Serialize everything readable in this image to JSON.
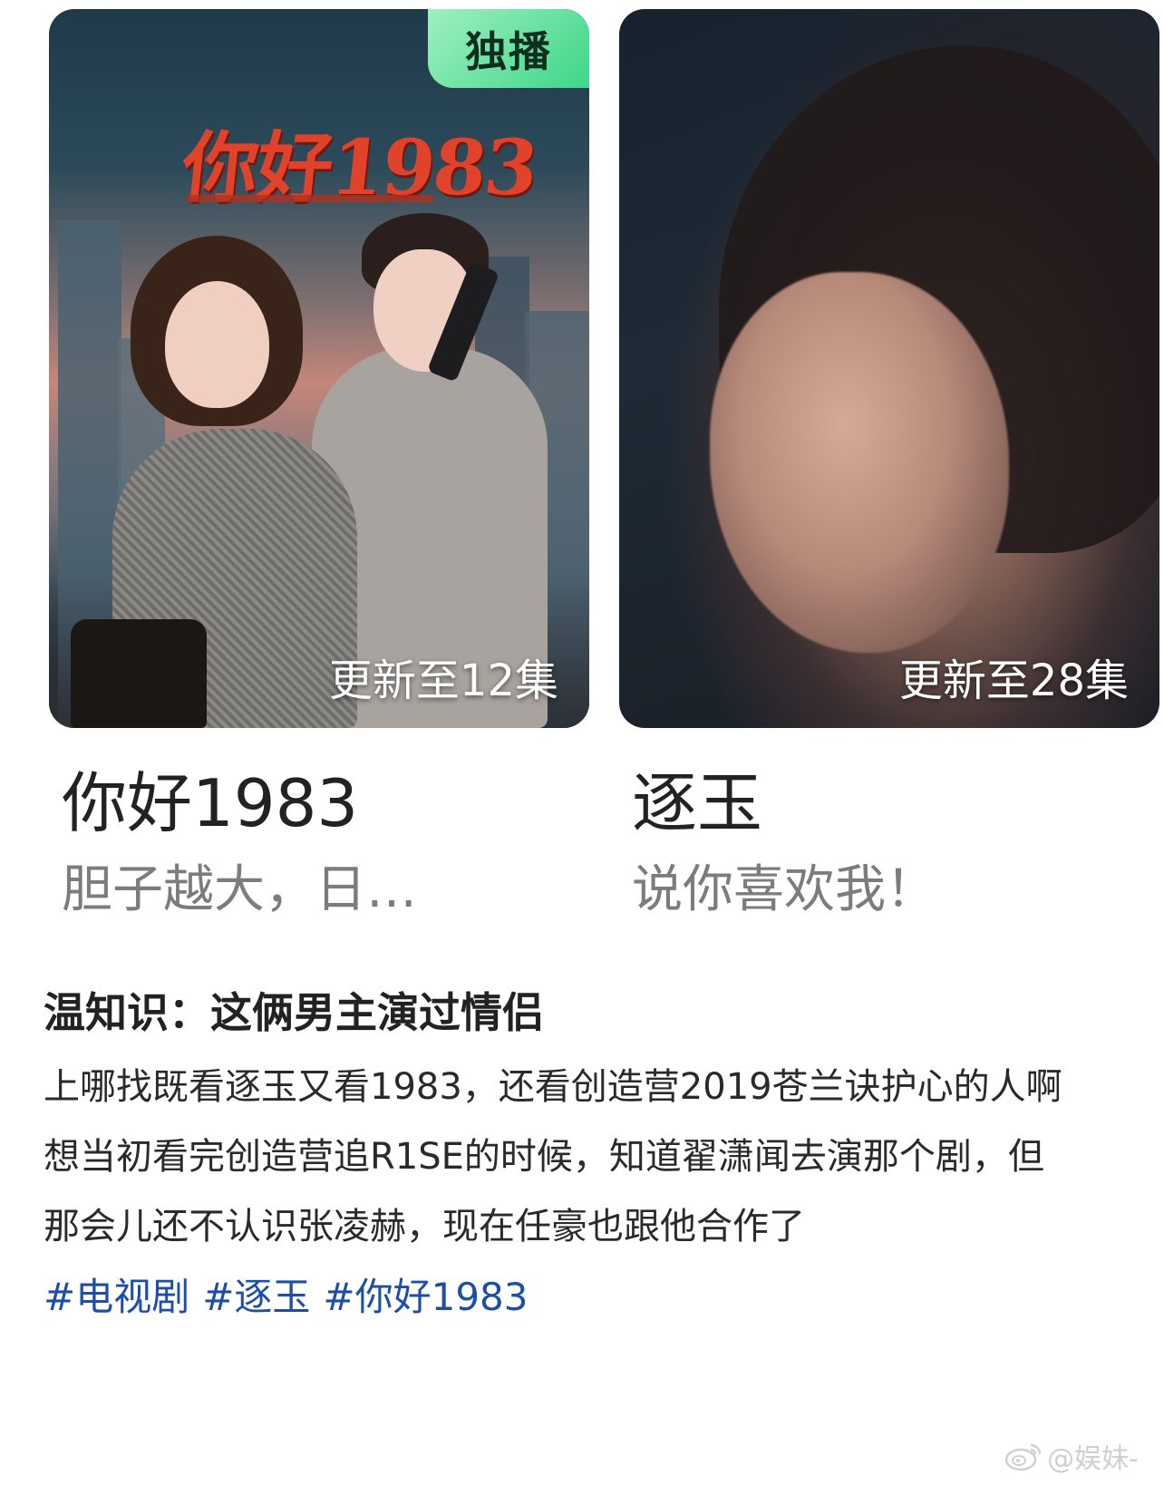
{
  "cards": [
    {
      "poster_title": "你好1983",
      "badge": "独播",
      "episode": "更新至12集",
      "title": "你好1983",
      "subtitle": "胆子越大，日…"
    },
    {
      "episode": "更新至28集",
      "title": "逐玉",
      "subtitle": "说你喜欢我！"
    }
  ],
  "post": {
    "heading": "温知识：这俩男主演过情侣",
    "lines": [
      "上哪找既看逐玉又看1983，还看创造营2019苍兰诀护心的人啊",
      "想当初看完创造营追R1SE的时候，知道翟潇闻去演那个剧，但那会儿还不认识张凌赫，现在任豪也跟他合作了"
    ],
    "tags": [
      "#电视剧",
      "#逐玉",
      "#你好1983"
    ]
  },
  "watermark": {
    "text": "@娱妹-"
  },
  "colors": {
    "badge": "#3ed68a",
    "poster_title": "#e0422a",
    "tag_link": "#1d4fa8",
    "subtitle": "#7c7c7c"
  },
  "icons": [
    "weibo-icon"
  ]
}
